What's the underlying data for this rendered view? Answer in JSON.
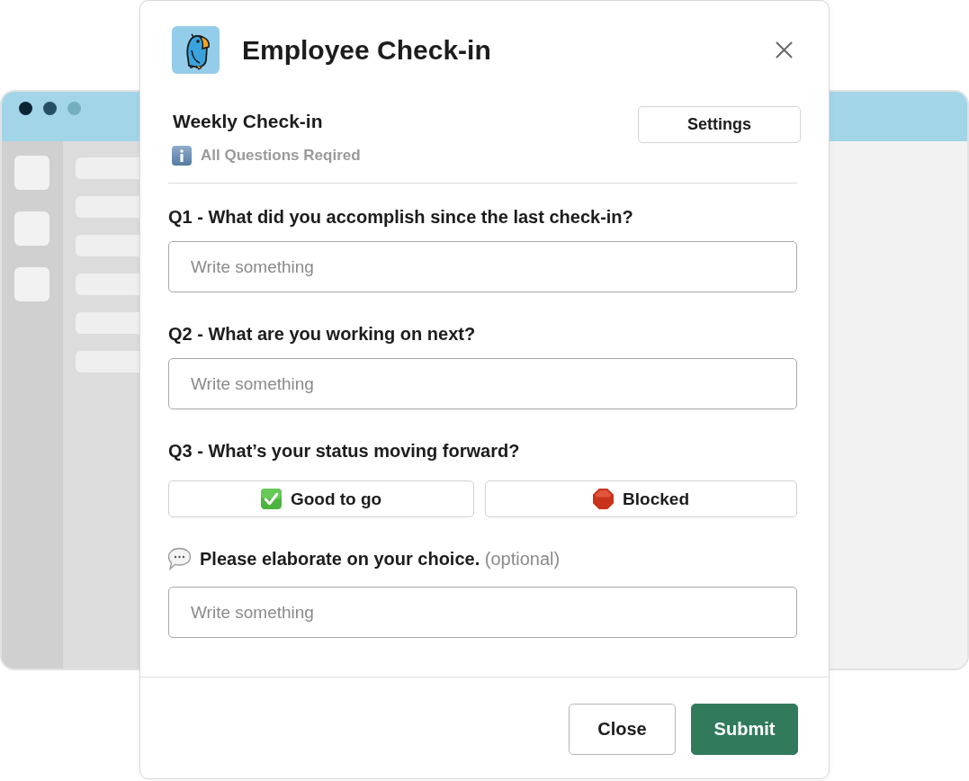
{
  "dialog": {
    "title": "Employee Check-in"
  },
  "checkin": {
    "title": "Weekly Check-in",
    "note": "All Questions Reqired",
    "settings_button": "Settings"
  },
  "questions": [
    {
      "kind": "text",
      "label": "Q1 - What did you accomplish since the last check-in?",
      "placeholder": "Write something"
    },
    {
      "kind": "text",
      "label": "Q2 - What are you working on next?",
      "placeholder": "Write something"
    },
    {
      "kind": "choice",
      "label": "Q3 - What’s your status moving forward?",
      "options": [
        {
          "kind": "go",
          "label": "Good to go",
          "selected": false
        },
        {
          "kind": "blocked",
          "label": "Blocked",
          "selected": false
        }
      ]
    },
    {
      "kind": "comment",
      "label": "Please elaborate on your choice.",
      "hint": "(optional)",
      "placeholder": "Write something"
    }
  ],
  "footer": {
    "buttons": [
      {
        "kind": "secondary",
        "label": "Close"
      },
      {
        "kind": "primary",
        "label": "Submit"
      }
    ]
  }
}
